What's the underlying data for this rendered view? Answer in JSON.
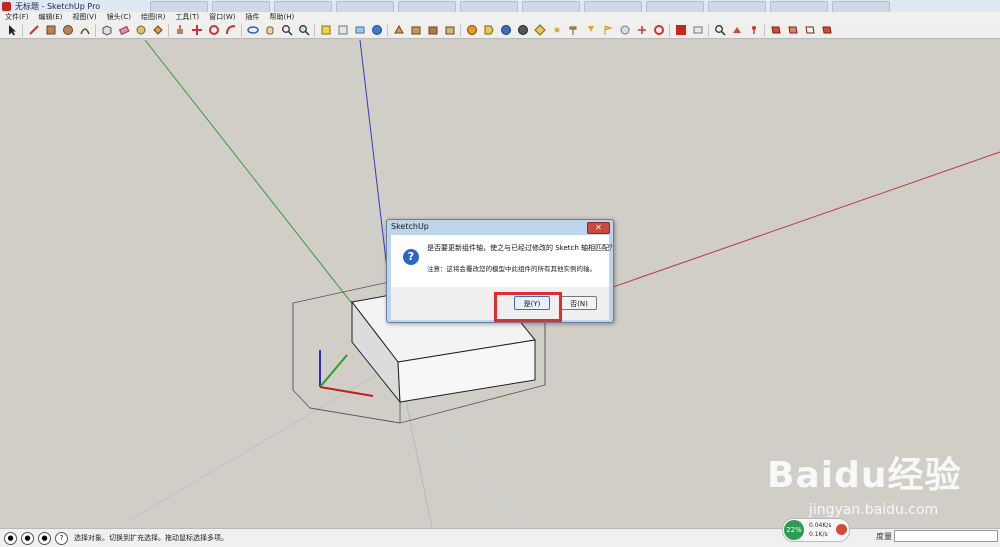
{
  "window": {
    "title": "无标题 - SketchUp Pro"
  },
  "menubar": {
    "items": [
      "文件(F)",
      "编辑(E)",
      "视图(V)",
      "镜头(C)",
      "绘图(R)",
      "工具(T)",
      "窗口(W)",
      "插件",
      "帮助(H)"
    ]
  },
  "dialog": {
    "title": "SketchUp",
    "message": "是否要更新组件轴，使之与已经过修改的 Sketch 轴相匹配？",
    "note": "注意：这将会覆改您的模型中此组件的所有其他实例的轴。",
    "yes_label": "是(Y)",
    "no_label": "否(N)",
    "close_glyph": "✕",
    "question_glyph": "?"
  },
  "statusbar": {
    "hint": "选择对象。切换到扩充选择。拖动鼠标选择多项。",
    "measure_label": "度量"
  },
  "network": {
    "percent": "22%",
    "up": "0.04K/s",
    "down": "0.1K/s"
  },
  "watermark": {
    "text": "Baidu经验",
    "url": "jingyan.baidu.com"
  },
  "colors": {
    "axis_red": "#b43a3a",
    "axis_green": "#3a9a3a",
    "axis_blue": "#3a3ac0",
    "highlight": "#e12d2d"
  }
}
